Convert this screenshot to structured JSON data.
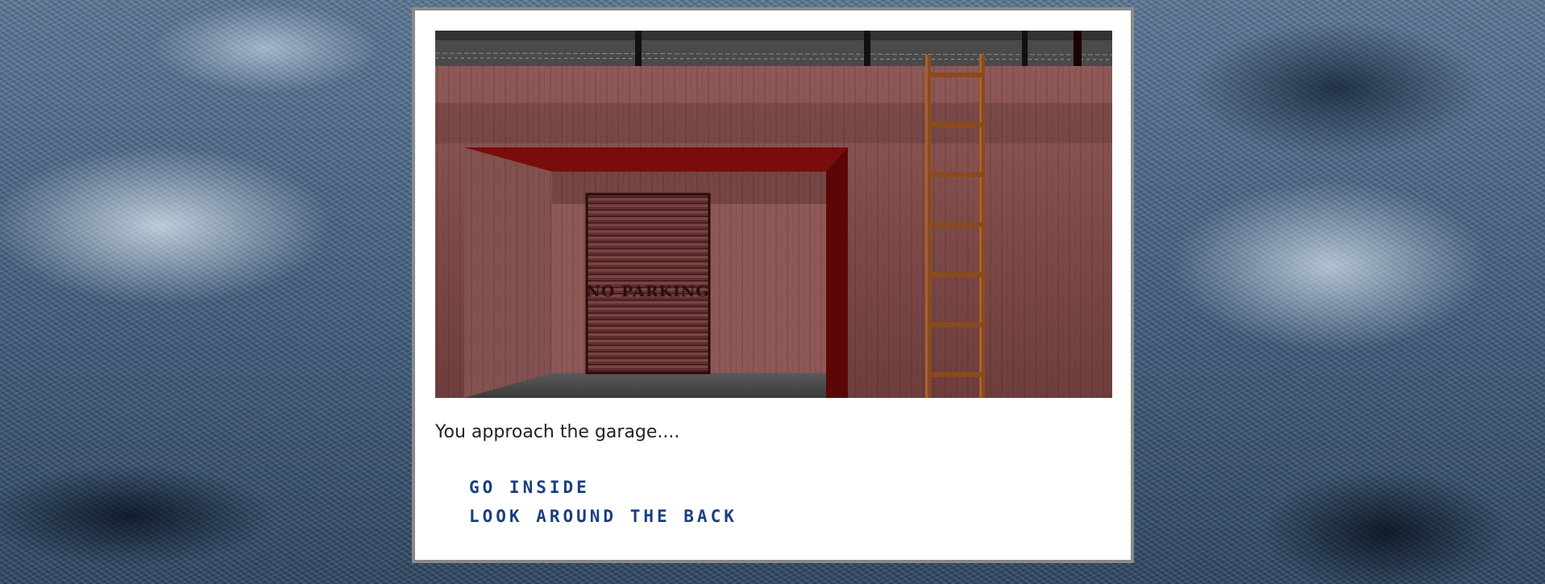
{
  "scene": {
    "sign_text": "NO PARKING"
  },
  "narration": "You approach the garage....",
  "choices": [
    {
      "label": "GO INSIDE"
    },
    {
      "label": "LOOK AROUND THE BACK"
    }
  ],
  "colors": {
    "choice_text": "#1a3f82",
    "wall": "#8a5553",
    "frame_red": "#7a0c0c",
    "ladder": "#8a4a1c",
    "window_border": "#8a8a8a"
  }
}
